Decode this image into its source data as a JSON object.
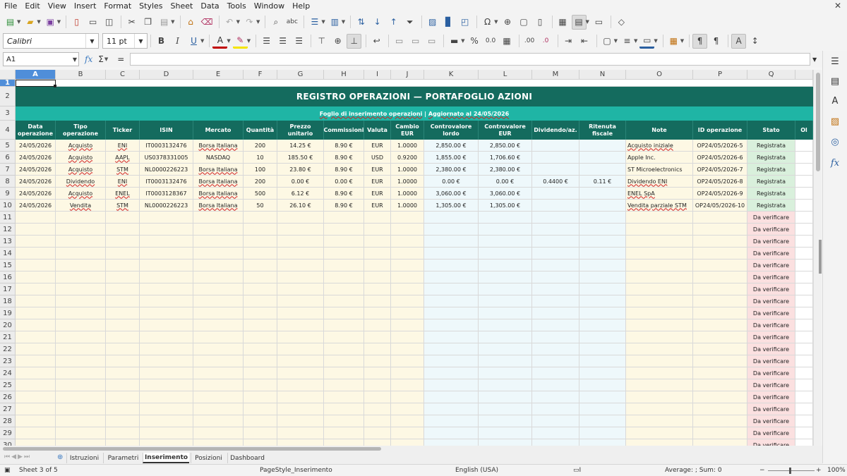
{
  "menu": [
    "File",
    "Edit",
    "View",
    "Insert",
    "Format",
    "Styles",
    "Sheet",
    "Data",
    "Tools",
    "Window",
    "Help"
  ],
  "formatting": {
    "font_name": "Calibri",
    "font_size": "11 pt"
  },
  "formula_bar": {
    "cell_ref": "A1",
    "fx_label": "fx",
    "sum_label": "Σ",
    "equals_label": "=",
    "content": ""
  },
  "column_letters": [
    "A",
    "B",
    "C",
    "D",
    "E",
    "F",
    "G",
    "H",
    "I",
    "J",
    "K",
    "L",
    "M",
    "N",
    "O",
    "P",
    "Q"
  ],
  "row_numbers": [
    "1",
    "2",
    "3",
    "4",
    "5",
    "6",
    "7",
    "8",
    "9",
    "10",
    "11",
    "12",
    "13",
    "14",
    "15",
    "16",
    "17",
    "18",
    "19",
    "20",
    "21",
    "22",
    "23",
    "24",
    "25",
    "26",
    "27",
    "28",
    "29",
    "30"
  ],
  "sheet": {
    "title": "REGISTRO OPERAZIONI — PORTAFOGLIO AZIONI",
    "subtitle_part1": "Foglio di inserimento operazioni",
    "subtitle_sep": " | ",
    "subtitle_part2": "Aggiornato al 24/05/2026",
    "headers": [
      "Data operazione",
      "Tipo operazione",
      "Ticker",
      "ISIN",
      "Mercato",
      "Quantità",
      "Prezzo unitario",
      "Commissioni",
      "Valuta",
      "Cambio EUR",
      "Controvalore lordo",
      "Controvalore EUR",
      "Dividendo/az.",
      "Ritenuta fiscale",
      "Note",
      "ID operazione",
      "Stato",
      "Ol"
    ],
    "rows": [
      [
        "24/05/2026",
        "Acquisto",
        "ENI",
        "IT0003132476",
        "Borsa Italiana",
        "200",
        "14.25 €",
        "8.90 €",
        "EUR",
        "1.0000",
        "2,850.00 €",
        "2,850.00 €",
        "",
        "",
        "Acquisto iniziale",
        "OP24/05/2026-5",
        "Registrata"
      ],
      [
        "24/05/2026",
        "Acquisto",
        "AAPL",
        "US0378331005",
        "NASDAQ",
        "10",
        "185.50 €",
        "8.90 €",
        "USD",
        "0.9200",
        "1,855.00 €",
        "1,706.60 €",
        "",
        "",
        "Apple Inc.",
        "OP24/05/2026-6",
        "Registrata"
      ],
      [
        "24/05/2026",
        "Acquisto",
        "STM",
        "NL0000226223",
        "Borsa Italiana",
        "100",
        "23.80 €",
        "8.90 €",
        "EUR",
        "1.0000",
        "2,380.00 €",
        "2,380.00 €",
        "",
        "",
        "ST Microelectronics",
        "OP24/05/2026-7",
        "Registrata"
      ],
      [
        "24/05/2026",
        "Dividendo",
        "ENI",
        "IT0003132476",
        "Borsa Italiana",
        "200",
        "0.00 €",
        "0.00 €",
        "EUR",
        "1.0000",
        "0.00 €",
        "0.00 €",
        "0.4400 €",
        "0.11 €",
        "Dividendo ENI",
        "OP24/05/2026-8",
        "Registrata"
      ],
      [
        "24/05/2026",
        "Acquisto",
        "ENEL",
        "IT0003128367",
        "Borsa Italiana",
        "500",
        "6.12 €",
        "8.90 €",
        "EUR",
        "1.0000",
        "3,060.00 €",
        "3,060.00 €",
        "",
        "",
        "ENEL SpA",
        "OP24/05/2026-9",
        "Registrata"
      ],
      [
        "24/05/2026",
        "Vendita",
        "STM",
        "NL0000226223",
        "Borsa Italiana",
        "50",
        "26.10 €",
        "8.90 €",
        "EUR",
        "1.0000",
        "1,305.00 €",
        "1,305.00 €",
        "",
        "",
        "Vendita parziale STM",
        "OP24/05/2026-10",
        "Registrata"
      ]
    ],
    "pending_status": "Da verificare"
  },
  "tabs": [
    "Istruzioni",
    "Parametri",
    "Inserimento",
    "Posizioni",
    "Dashboard"
  ],
  "active_tab": "Inserimento",
  "status": {
    "sheet_pos": "Sheet 3 of 5",
    "page_style": "PageStyle_Inserimento",
    "language": "English (USA)",
    "aggregate": "Average: ; Sum: 0",
    "zoom": "100%"
  },
  "colors": {
    "title_bg": "#146b5e",
    "subtitle_bg": "#1fb5a5",
    "data_bg": "#fdf8e4",
    "alt_bg": "#eef8fb",
    "status_ok_bg": "#d9f0dc",
    "status_pending_bg": "#fbe0e0",
    "selection": "#4f8ed9"
  }
}
